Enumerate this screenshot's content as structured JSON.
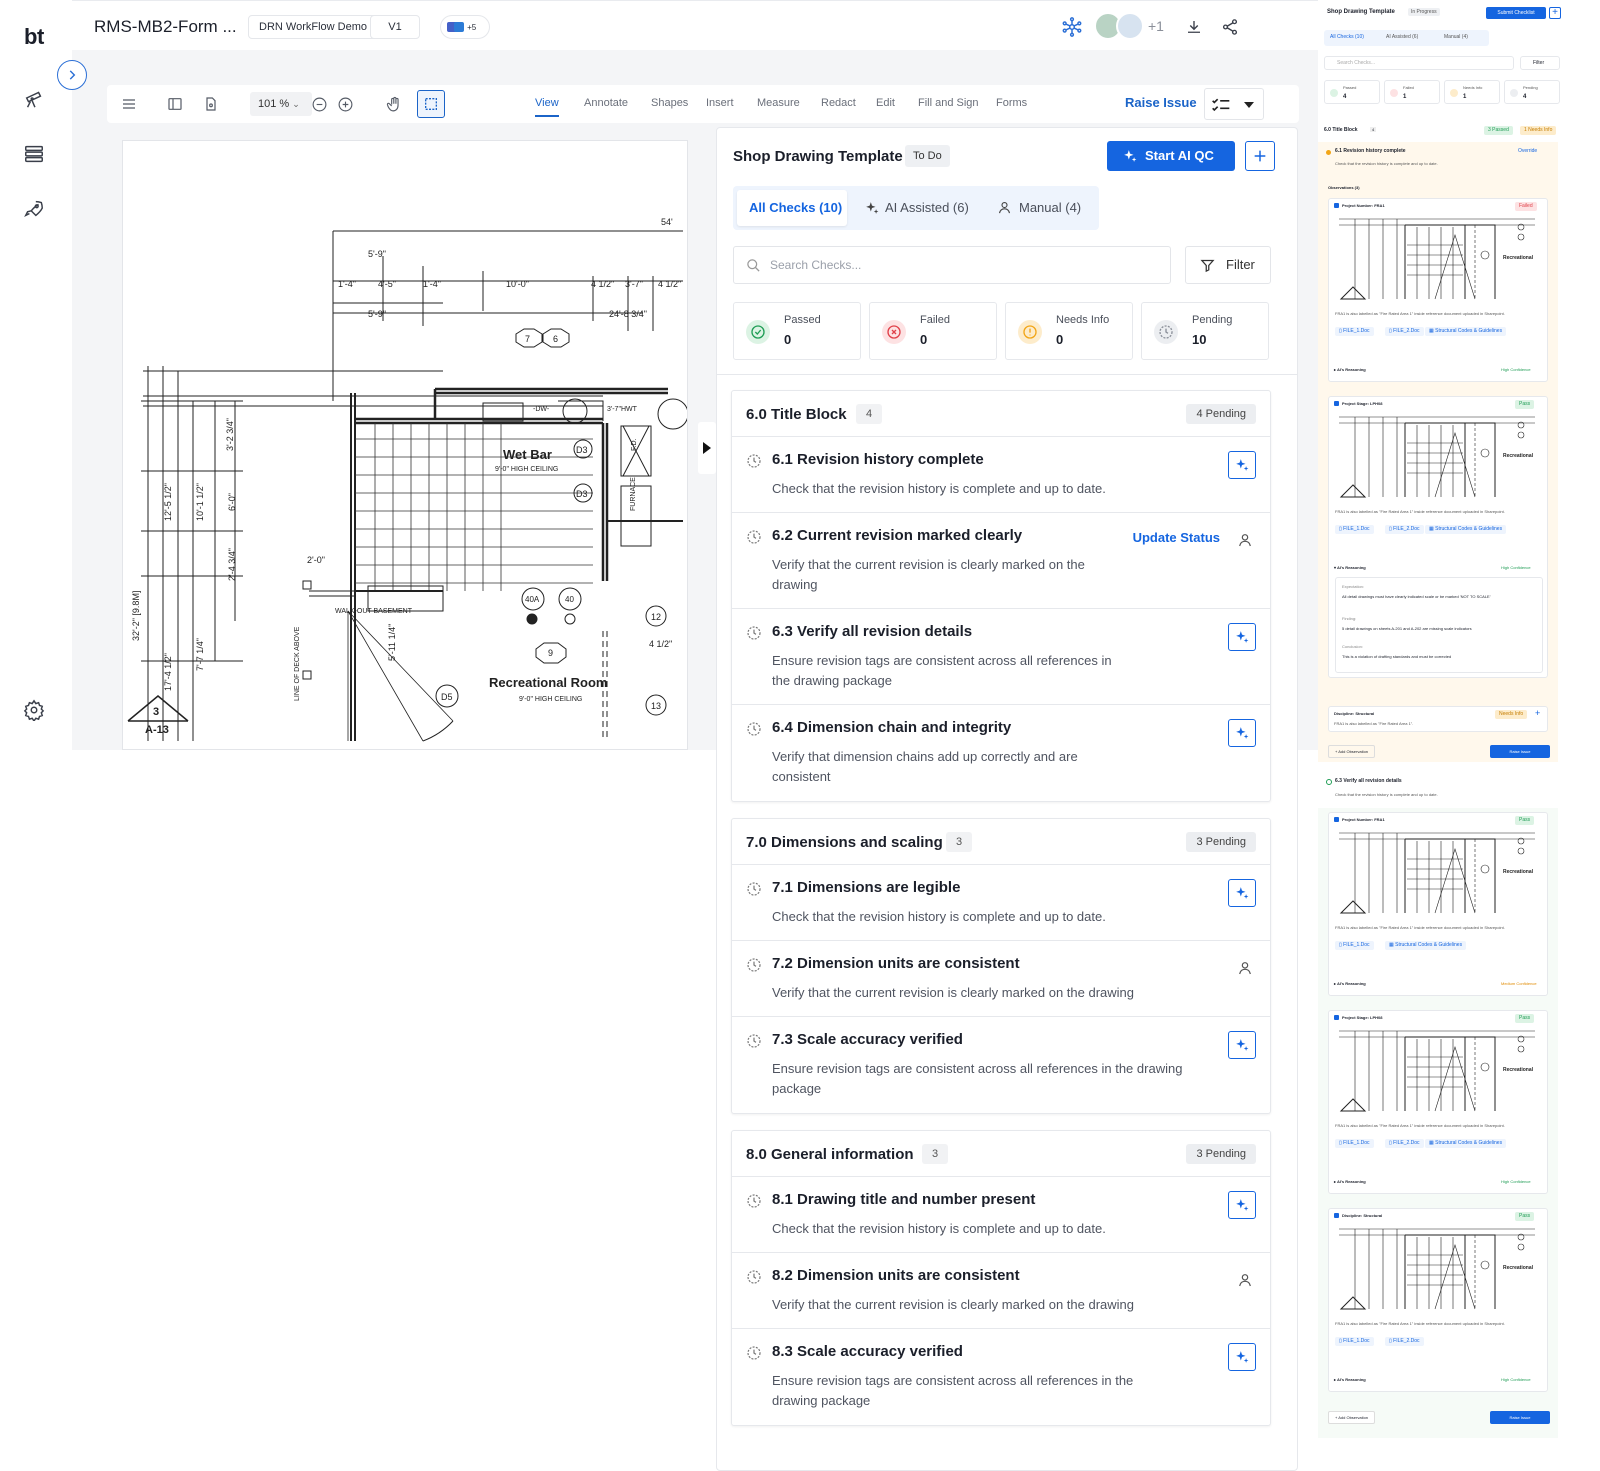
{
  "rail": {
    "logo": "bt"
  },
  "header": {
    "doc_title": "RMS-MB2-Form ...",
    "project_chip": "DRN WorkFlow Demo",
    "version_chip": "V1",
    "collaborators_extra": "+5",
    "avatars_extra": "+1"
  },
  "toolbar": {
    "zoom": "101 %",
    "tabs": [
      "View",
      "Annotate",
      "Shapes",
      "Insert",
      "Measure",
      "Redact",
      "Edit",
      "Fill and Sign",
      "Forms"
    ],
    "active_tab": "View",
    "raise_issue": "Raise Issue"
  },
  "drawing": {
    "labels": {
      "wet_bar": "Wet Bar",
      "wet_bar_ceiling": "9'-0\" HIGH CEILING",
      "rec_room": "Recreational Room",
      "rec_room_ceiling": "9'-0\" HIGH CEILING",
      "walkout": "WALK-OUT BASEMENT",
      "furnace": "FURNACE",
      "deck": "LINE OF DECK ABOVE",
      "dw": "-DW-",
      "hwt": "3'-7\"HWT",
      "fd": "F.D.",
      "d5": "D5",
      "d3a": "D3",
      "d3b": "D3",
      "a13": "A-13",
      "sheet": "3"
    },
    "dims": [
      "54'",
      "5'-9\"",
      "1'-4\"",
      "4'-5\"",
      "1'-4\"",
      "10'-0\"",
      "4 1/2\"",
      "3'-7\"",
      "4 1/2\"",
      "5'-9\"",
      "24'-8 3/4\"",
      "2'-0\"",
      "12'-5 1/2\"",
      "10'-1 1/2\"",
      "6'-0\"",
      "3'-2 3/4\"",
      "2'-4 3/4\"",
      "32'-2\" [9.8M]",
      "17'-4 1/2\"",
      "7'-7 1/4\"",
      "5'-11 1/4\"",
      "4 1/2\""
    ],
    "tags": [
      "7",
      "6",
      "40A",
      "40",
      "9",
      "12",
      "13"
    ]
  },
  "checklist": {
    "title": "Shop Drawing Template",
    "status": "To Do",
    "start_label": "Start AI QC",
    "tabs": [
      {
        "label": "All Checks (10)"
      },
      {
        "label": "AI Assisted (6)"
      },
      {
        "label": "Manual (4)"
      }
    ],
    "search_placeholder": "Search Checks...",
    "filter_label": "Filter",
    "stats": [
      {
        "label": "Passed",
        "value": "0",
        "color": "#1f9d55"
      },
      {
        "label": "Failed",
        "value": "0",
        "color": "#e0414a"
      },
      {
        "label": "Needs Info",
        "value": "0",
        "color": "#f2a516"
      },
      {
        "label": "Pending",
        "value": "10",
        "color": "#8a8f99"
      }
    ],
    "sections": [
      {
        "title": "6.0  Title Block",
        "count": "4",
        "pending": "4 Pending",
        "items": [
          {
            "title": "6.1  Revision history complete",
            "desc": "Check that the revision history is complete and up to date.",
            "action": "ai"
          },
          {
            "title": "6.2  Current revision marked clearly",
            "desc": "Verify that the current revision is clearly marked on the drawing",
            "action": "manual",
            "update": "Update Status"
          },
          {
            "title": "6.3  Verify all revision details",
            "desc": "Ensure revision tags are consistent across all references in the drawing package",
            "action": "ai"
          },
          {
            "title": "6.4  Dimension chain and integrity",
            "desc": "Verify that dimension chains add up correctly and are consistent",
            "action": "ai"
          }
        ]
      },
      {
        "title": "7.0  Dimensions and scaling",
        "count": "3",
        "pending": "3 Pending",
        "items": [
          {
            "title": "7.1  Dimensions are legible",
            "desc": "Check that the revision history is complete and up to date.",
            "action": "ai"
          },
          {
            "title": "7.2  Dimension units are consistent",
            "desc": "Verify that the current revision is clearly marked on the drawing",
            "action": "manual"
          },
          {
            "title": "7.3  Scale accuracy verified",
            "desc": "Ensure revision tags are consistent across all references in the drawing package",
            "action": "ai"
          }
        ]
      },
      {
        "title": "8.0  General information",
        "count": "3",
        "pending": "3 Pending",
        "items": [
          {
            "title": "8.1  Drawing title and number present",
            "desc": "Check that the revision history is complete and up to date.",
            "action": "ai"
          },
          {
            "title": "8.2  Dimension units are consistent",
            "desc": "Verify that the current revision is clearly marked on the drawing",
            "action": "manual"
          },
          {
            "title": "8.3  Scale accuracy verified",
            "desc": "Ensure revision tags are consistent across all references in the drawing package",
            "action": "ai"
          }
        ]
      }
    ]
  },
  "side_preview": {
    "title": "Shop Drawing Template",
    "status": "In Progress",
    "submit": "Submit Checklist",
    "tabs": [
      "All Checks (10)",
      "AI Assisted (6)",
      "Manual (4)"
    ],
    "search_placeholder": "Search Checks...",
    "filter": "Filter",
    "stats": [
      {
        "label": "Passed",
        "value": "4"
      },
      {
        "label": "Failed",
        "value": "1"
      },
      {
        "label": "Needs Info",
        "value": "1"
      },
      {
        "label": "Pending",
        "value": "4"
      }
    ],
    "section_title": "6.0  Title Block",
    "section_count": "4",
    "section_passed": "3 Passed",
    "section_needs": "1 Needs Info",
    "item1_title": "6.1  Revision history complete",
    "item1_desc": "Check that the revision history is complete and up to date.",
    "override": "Override",
    "observations": "Observations (3)",
    "obs_note": "FRA1 is also labelled as \"Fire Rated Area 1\" inside reference document uploaded in Sharepoint.",
    "file1": "FILE_1.Doc",
    "file2": "FILE_2.Doc",
    "codes": "Structural Codes & Guidelines",
    "ai_reasoning": "AI's Reasoning",
    "high_conf": "High Confidence",
    "medium_conf": "Medium Confidence",
    "failed_tag": "Failed",
    "pass_tag": "Pass",
    "needs_tag": "Needs Info",
    "recreational": "Recreational",
    "cards": [
      {
        "label": "Project Number: FRA1"
      },
      {
        "label": "Project Stage: LPH08"
      },
      {
        "label": "Project Number: FRA1"
      },
      {
        "label": "Project Stage: LPH08"
      },
      {
        "label": "Discipline: Structural"
      }
    ],
    "expectation_label": "Expectation:",
    "expectation": "All detail drawings must have clearly indicated scale or be marked 'NOT TO SCALE'",
    "finding_label": "Finding:",
    "finding": "5 detail drawings on sheets A-201 and A-202 are missing scale indicators",
    "conclusion_label": "Conclusion:",
    "conclusion": "This is a violation of drafting standards and must be corrected",
    "discipline": "Discipline: Structural",
    "discipline_note": "FRA1 is also labelled as \"Fire Rated Area 1\".",
    "add_observation": "+ Add Observation",
    "raise_issue": "Raise Issue",
    "item3_title": "6.3  Verify all revision details",
    "item3_desc": "Check that the revision history is complete and up to date."
  }
}
